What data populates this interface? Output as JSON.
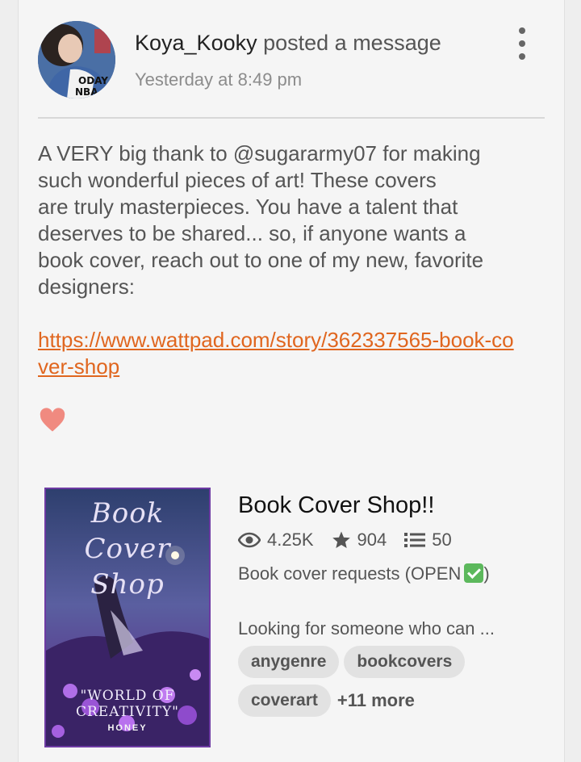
{
  "post": {
    "author": "Koya_Kooky",
    "action": " posted a message",
    "timestamp": "Yesterday at 8:49 pm",
    "avatar_text": "ODAY NBA",
    "body_lines": [
      "A VERY big thank to @sugararmy07 for making",
      "such wonderful pieces of art! These covers",
      "are truly masterpieces. You have a talent that",
      "deserves to be shared... so, if anyone wants a",
      "book cover, reach out to one of my new, favorite",
      "designers:"
    ],
    "link": "https://www.wattpad.com/story/362337565-book-cover-shop",
    "emoji": "heart"
  },
  "story": {
    "title": "Book Cover Shop!!",
    "reads": "4.25K",
    "votes": "904",
    "parts": "50",
    "subtitle": "Book cover requests (OPEN",
    "description": "Looking for someone who can ...",
    "tags": [
      "anygenre",
      "bookcovers",
      "coverart"
    ],
    "more_tags": "+11 more",
    "cover": {
      "title_line1": "Book Cover",
      "title_line2": "Shop",
      "subtitle": "\"WORLD OF CREATIVITY\"",
      "author": "HONEY"
    }
  },
  "colors": {
    "link": "#e0661f",
    "heart": "#f08a80",
    "check": "#5cb85c",
    "cover_border": "#6d3aa3"
  }
}
